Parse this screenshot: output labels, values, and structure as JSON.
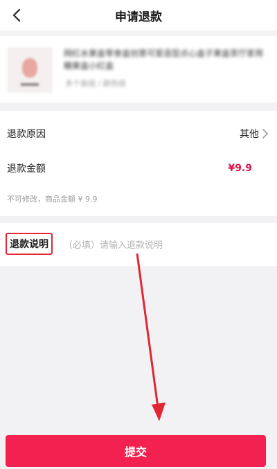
{
  "header": {
    "title": "申请退款",
    "back_icon": "chevron-left-icon"
  },
  "product": {
    "title": "网红水果盒零食盒创意可爱造型点心盒子果盒茶厅家用糖果盒小红盒",
    "spec": "多个装组 / 颜色组"
  },
  "refund": {
    "reason_label": "退款原因",
    "reason_value": "其他",
    "amount_label": "退款金额",
    "amount_value": "¥9.9",
    "note": "不可修改，商品金额 ¥ 9.9"
  },
  "remark": {
    "label": "退款说明",
    "placeholder": "（必填）请输入退款说明",
    "value": ""
  },
  "submit_label": "提交",
  "colors": {
    "accent": "#f2214f",
    "price": "#d8194d",
    "highlight_box": "#e32432"
  }
}
